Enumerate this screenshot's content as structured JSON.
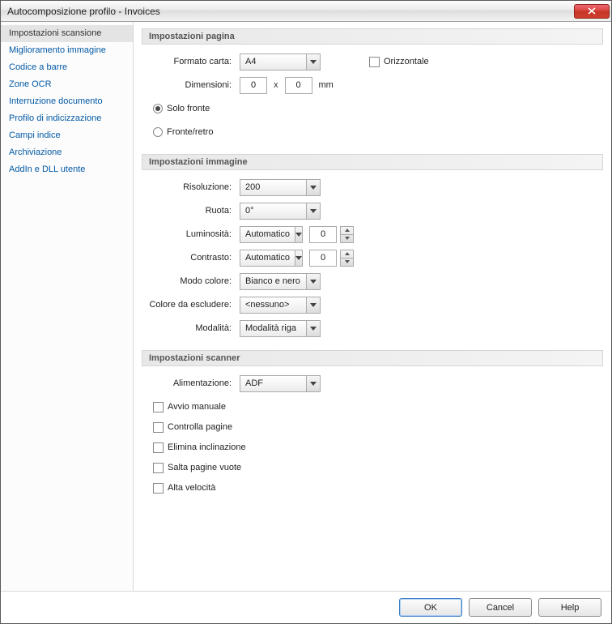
{
  "window": {
    "title": "Autocomposizione profilo - Invoices"
  },
  "sidebar": {
    "items": [
      {
        "label": "Impostazioni scansione",
        "active": true
      },
      {
        "label": "Miglioramento immagine"
      },
      {
        "label": "Codice a barre"
      },
      {
        "label": "Zone OCR"
      },
      {
        "label": "Interruzione documento"
      },
      {
        "label": "Profilo di indicizzazione"
      },
      {
        "label": "Campi indice"
      },
      {
        "label": "Archiviazione"
      },
      {
        "label": "AddIn e DLL utente"
      }
    ]
  },
  "sections": {
    "page": {
      "title": "Impostazioni pagina",
      "paper_label": "Formato carta:",
      "paper_value": "A4",
      "landscape_label": "Orizzontale",
      "dim_label": "Dimensioni:",
      "dim_w": "0",
      "dim_h": "0",
      "dim_unit": "mm",
      "front_only": "Solo fronte",
      "duplex": "Fronte/retro"
    },
    "image": {
      "title": "Impostazioni immagine",
      "resolution_label": "Risoluzione:",
      "resolution_value": "200",
      "rotate_label": "Ruota:",
      "rotate_value": "0°",
      "brightness_label": "Luminosità:",
      "brightness_value": "Automatico",
      "brightness_num": "0",
      "contrast_label": "Contrasto:",
      "contrast_value": "Automatico",
      "contrast_num": "0",
      "colormode_label": "Modo colore:",
      "colormode_value": "Bianco e nero",
      "dropout_label": "Colore da escludere:",
      "dropout_value": "<nessuno>",
      "mode_label": "Modalità:",
      "mode_value": "Modalità riga"
    },
    "scanner": {
      "title": "Impostazioni scanner",
      "feed_label": "Alimentazione:",
      "feed_value": "ADF",
      "manual_start": "Avvio manuale",
      "check_pages": "Controlla pagine",
      "deskew": "Elimina inclinazione",
      "skip_blank": "Salta pagine vuote",
      "high_speed": "Alta velocità"
    }
  },
  "footer": {
    "ok": "OK",
    "cancel": "Cancel",
    "help": "Help"
  }
}
